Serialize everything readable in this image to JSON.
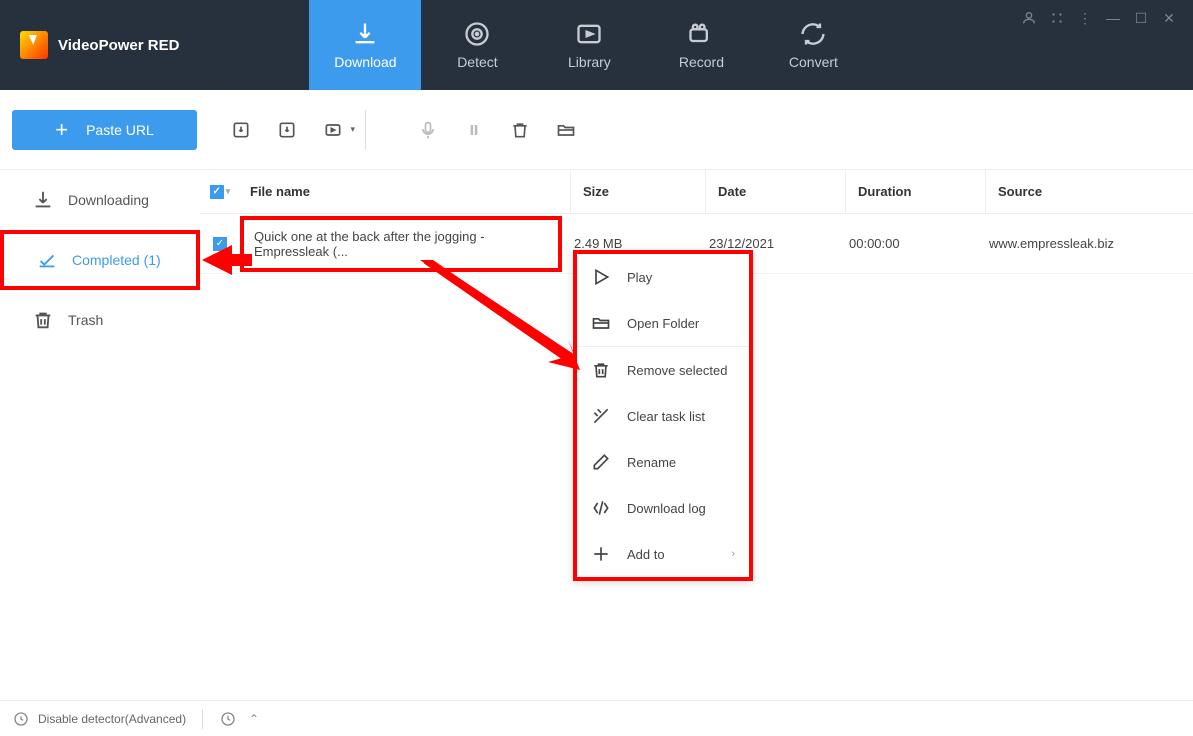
{
  "app": {
    "title": "VideoPower RED"
  },
  "nav": {
    "download": "Download",
    "detect": "Detect",
    "library": "Library",
    "record": "Record",
    "convert": "Convert"
  },
  "toolbar": {
    "paste": "Paste URL"
  },
  "sidebar": {
    "downloading": "Downloading",
    "completed": "Completed (1)",
    "trash": "Trash"
  },
  "table": {
    "headers": {
      "filename": "File name",
      "size": "Size",
      "date": "Date",
      "duration": "Duration",
      "source": "Source"
    },
    "row": {
      "filename": "Quick one at the back after the jogging - Empressleak (...",
      "size": "2.49 MB",
      "date": "23/12/2021",
      "duration": "00:00:00",
      "source": "www.empressleak.biz"
    }
  },
  "context": {
    "play": "Play",
    "openFolder": "Open Folder",
    "removeSelected": "Remove selected",
    "clearTaskList": "Clear task list",
    "rename": "Rename",
    "downloadLog": "Download log",
    "addTo": "Add to"
  },
  "status": {
    "disable": "Disable detector(Advanced)"
  }
}
